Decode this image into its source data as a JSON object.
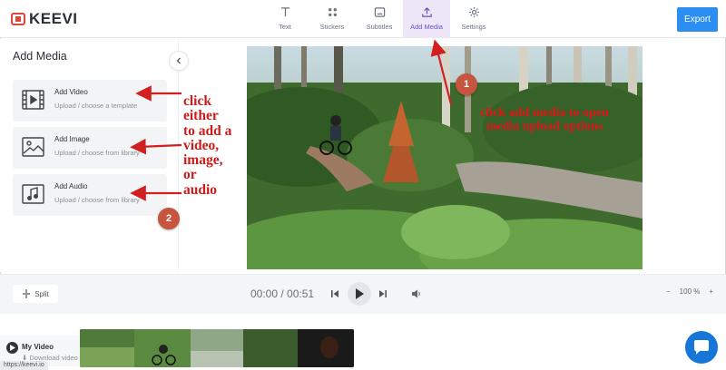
{
  "app": {
    "name": "KEEVI"
  },
  "toolbar": {
    "tools": [
      {
        "label": "Text",
        "icon": "text-icon"
      },
      {
        "label": "Stickers",
        "icon": "stickers-icon"
      },
      {
        "label": "Subtitles",
        "icon": "subtitles-icon"
      },
      {
        "label": "Add Media",
        "icon": "upload-icon",
        "active": true
      },
      {
        "label": "Settings",
        "icon": "gear-icon"
      }
    ],
    "export_label": "Export"
  },
  "left_panel": {
    "title": "Add Media",
    "items": [
      {
        "title": "Add Video",
        "subtitle": "Upload / choose a template",
        "icon": "video-file-icon"
      },
      {
        "title": "Add Image",
        "subtitle": "Upload / choose from library",
        "icon": "image-file-icon"
      },
      {
        "title": "Add Audio",
        "subtitle": "Upload / choose from library",
        "icon": "music-file-icon"
      }
    ]
  },
  "controls": {
    "split_label": "Split",
    "time": "00:00 / 00:51",
    "zoom": {
      "minus": "−",
      "value": "100 %",
      "plus": "+"
    }
  },
  "timeline": {
    "track_name": "My Video",
    "download_label": "Download video"
  },
  "status_url": "https://keevi.io",
  "annotations": {
    "left_text": [
      "click",
      "either",
      "to add a",
      "video,",
      "image,",
      "or",
      "audio"
    ],
    "right_text": [
      "click add media to open",
      "media upload options"
    ],
    "badge_1": "1",
    "badge_2": "2"
  },
  "colors": {
    "accent": "#2b8ef0",
    "active_tool_bg": "#ece6f7",
    "annotation_red": "#d21f1f",
    "badge": "#c7543e"
  }
}
